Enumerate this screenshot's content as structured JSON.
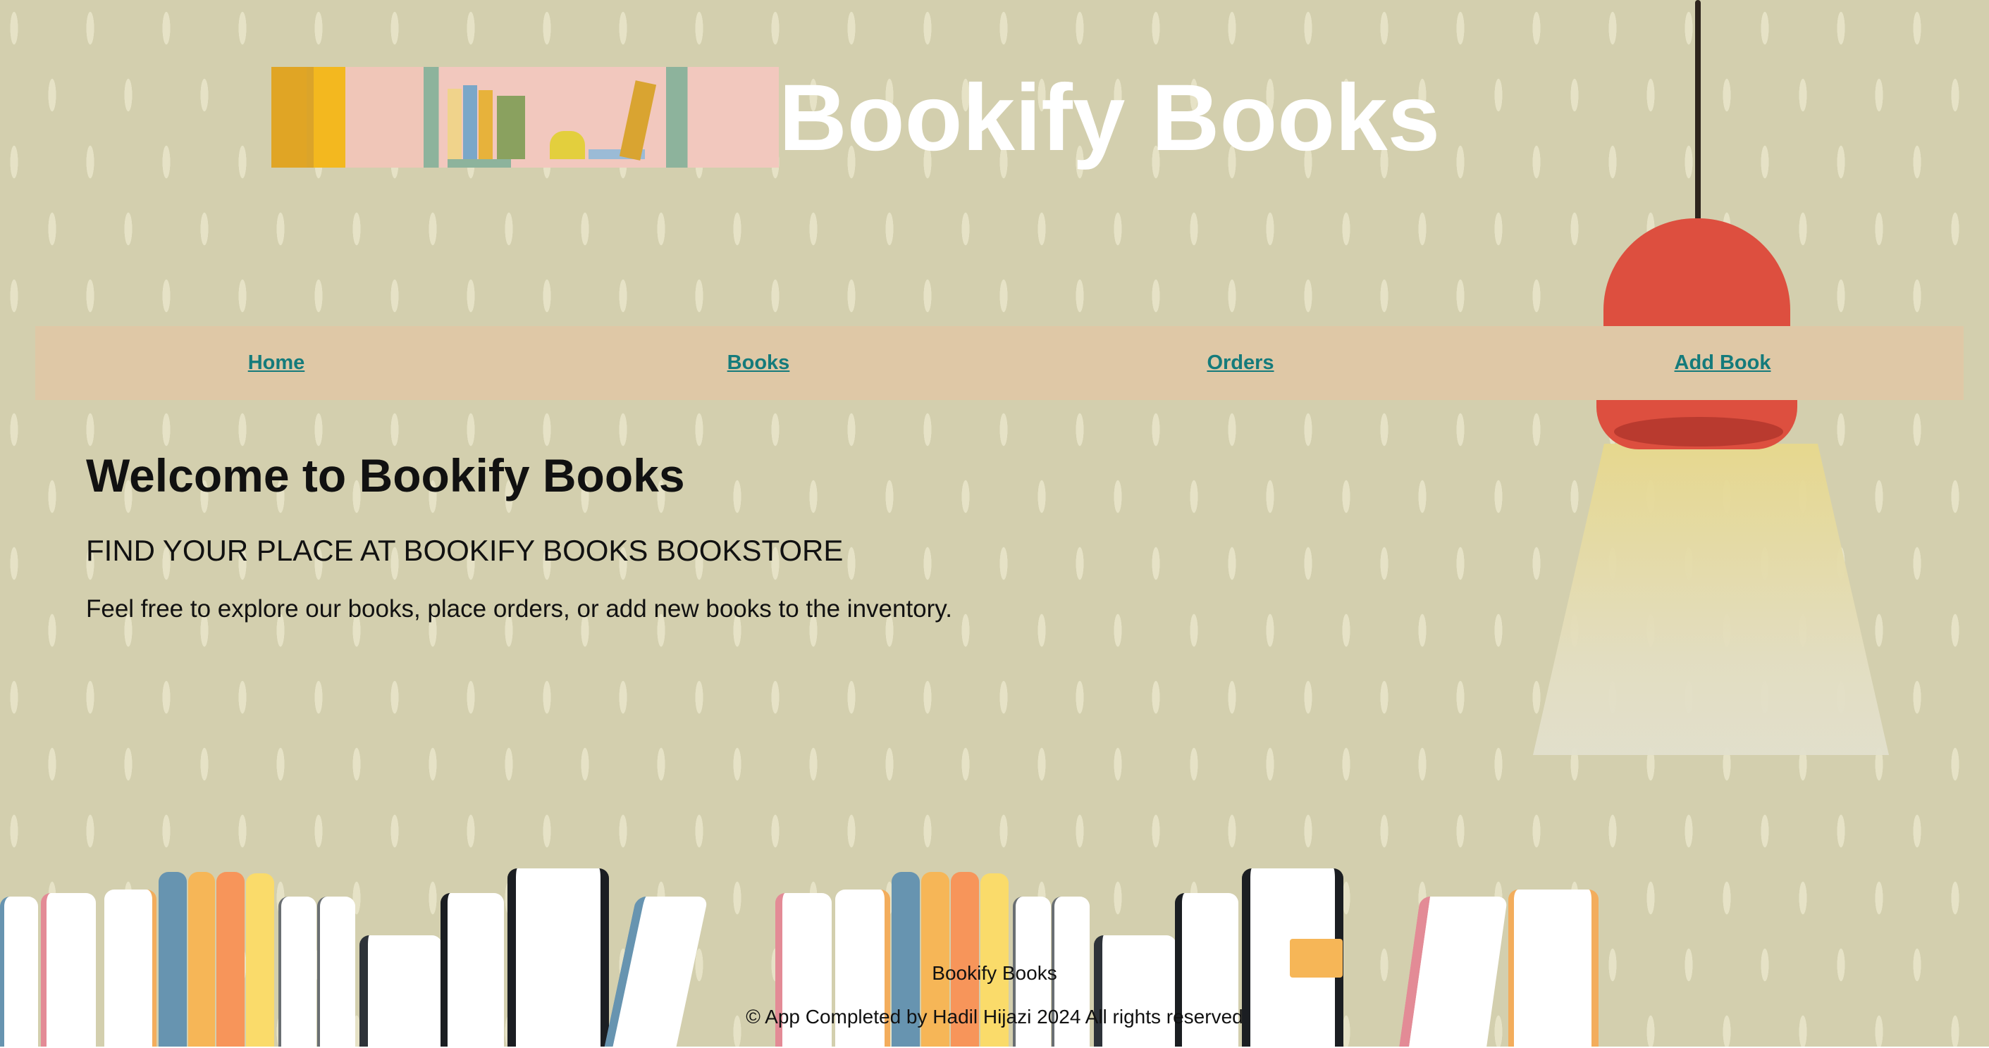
{
  "header": {
    "title": "Bookify Books"
  },
  "nav": {
    "items": [
      {
        "label": "Home"
      },
      {
        "label": "Books"
      },
      {
        "label": "Orders"
      },
      {
        "label": "Add Book"
      }
    ]
  },
  "main": {
    "heading": "Welcome to Bookify Books",
    "subheading": "FIND YOUR PLACE AT BOOKIFY BOOKS BOOKSTORE",
    "body": "Feel free to explore our books, place orders, or add new books to the inventory."
  },
  "footer": {
    "name": "Bookify Books",
    "copyright": "© App Completed by Hadil Hijazi 2024 All rights reserved"
  },
  "colors": {
    "background": "#d3cfae",
    "nav_bg": "#dfc8a6",
    "link": "#157b7b",
    "title": "#ffffff",
    "lamp": "#dd4f3f"
  }
}
